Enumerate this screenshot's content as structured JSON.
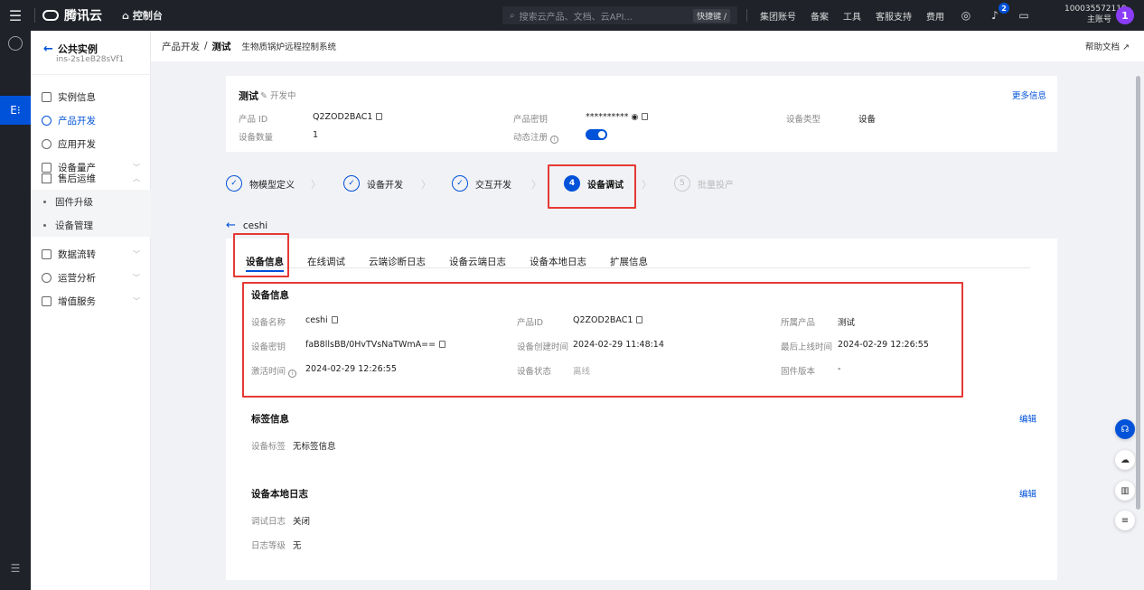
{
  "topbar": {
    "brand": "腾讯云",
    "console": "控制台",
    "search_placeholder": "搜索云产品、文档、云API...",
    "search_shortcut": "快捷键 /",
    "nav": [
      "集团账号",
      "备案",
      "工具",
      "客服支持",
      "费用"
    ],
    "notification_count": "2",
    "account_id": "100035572119",
    "account_role": "主账号",
    "avatar": "1"
  },
  "sidebar": {
    "back_label": "公共实例",
    "instance_id": "ins-2s1eB28sVf1",
    "items": [
      {
        "label": "实例信息"
      },
      {
        "label": "产品开发"
      },
      {
        "label": "应用开发"
      },
      {
        "label": "设备量产"
      },
      {
        "label": "售后运维"
      },
      {
        "label": "固件升级"
      },
      {
        "label": "设备管理"
      },
      {
        "label": "数据流转"
      },
      {
        "label": "运营分析"
      },
      {
        "label": "增值服务"
      }
    ]
  },
  "breadcrumb": {
    "root": "产品开发",
    "sep": "/",
    "current": "测试",
    "desc": "生物质锅炉远程控制系统",
    "help": "帮助文档"
  },
  "product": {
    "name": "测试",
    "status": "开发中",
    "more": "更多信息",
    "product_id_label": "产品 ID",
    "product_id": "Q2ZOD2BAC1",
    "secret_label": "产品密钥",
    "secret": "**********",
    "type_label": "设备类型",
    "type": "设备",
    "count_label": "设备数量",
    "count": "1",
    "dynreg_label": "动态注册"
  },
  "steps": [
    {
      "num": "1",
      "label": "物模型定义"
    },
    {
      "num": "2",
      "label": "设备开发"
    },
    {
      "num": "3",
      "label": "交互开发"
    },
    {
      "num": "4",
      "label": "设备调试"
    },
    {
      "num": "5",
      "label": "批量投产"
    }
  ],
  "device": {
    "name": "ceshi",
    "tabs": [
      "设备信息",
      "在线调试",
      "云端诊断日志",
      "设备云端日志",
      "设备本地日志",
      "扩展信息"
    ],
    "info_title": "设备信息",
    "info": {
      "name_label": "设备名称",
      "name": "ceshi",
      "pid_label": "产品ID",
      "pid": "Q2ZOD2BAC1",
      "product_label": "所属产品",
      "product": "测试",
      "secret_label": "设备密钥",
      "secret": "faB8llsBB/0HvTVsNaTWmA==",
      "created_label": "设备创建时间",
      "created": "2024-02-29 11:48:14",
      "online_label": "最后上线时间",
      "online": "2024-02-29 12:26:55",
      "activated_label": "激活时间",
      "activated": "2024-02-29 12:26:55",
      "state_label": "设备状态",
      "state": "离线",
      "fw_label": "固件版本",
      "fw": "-"
    },
    "tags_title": "标签信息",
    "tags_edit": "编辑",
    "tags_label": "设备标签",
    "tags_value": "无标签信息",
    "local_title": "设备本地日志",
    "local_edit": "编辑",
    "debug_label": "调试日志",
    "debug_value": "关闭",
    "level_label": "日志等级",
    "level_value": "无"
  }
}
